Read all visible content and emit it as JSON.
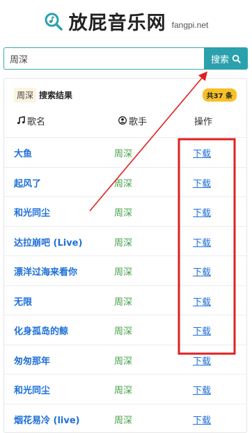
{
  "header": {
    "icon": "magnifier-music-icon",
    "title": "放屁音乐网",
    "domain": "fangpi.net",
    "accent": "#2aa1ad"
  },
  "search": {
    "value": "周深",
    "button_label": "搜索",
    "button_icon": "search-icon"
  },
  "results": {
    "keyword": "周深",
    "title": "搜索结果",
    "count": "共37 条",
    "columns": {
      "song": "歌名",
      "singer": "歌手",
      "action": "操作"
    },
    "rows": [
      {
        "song": "大鱼",
        "singer": "周深",
        "action": "下载"
      },
      {
        "song": "起风了",
        "singer": "周深",
        "action": "下载"
      },
      {
        "song": "和光同尘",
        "singer": "周深",
        "action": "下载"
      },
      {
        "song": "达拉崩吧 (Live)",
        "singer": "周深",
        "action": "下载"
      },
      {
        "song": "漂洋过海来看你",
        "singer": "周深",
        "action": "下载"
      },
      {
        "song": "无限",
        "singer": "周深",
        "action": "下载"
      },
      {
        "song": "化身孤岛的鲸",
        "singer": "周深",
        "action": "下载"
      },
      {
        "song": "匆匆那年",
        "singer": "周深",
        "action": "下载"
      },
      {
        "song": "和光同尘",
        "singer": "周深",
        "action": "下载"
      },
      {
        "song": "烟花易冷 (live)",
        "singer": "周深",
        "action": "下载"
      }
    ]
  },
  "annotation": {
    "color": "#e02020"
  }
}
